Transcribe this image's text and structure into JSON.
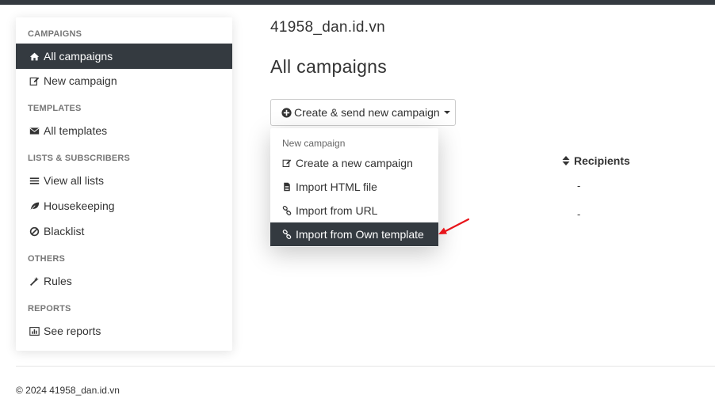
{
  "site_title": "41958_dan.id.vn",
  "page_title": "All campaigns",
  "sidebar": {
    "sections": [
      {
        "heading": "CAMPAIGNS",
        "items": [
          {
            "label": "All campaigns",
            "icon": "home-icon",
            "active": true
          },
          {
            "label": "New campaign",
            "icon": "edit-icon"
          }
        ]
      },
      {
        "heading": "TEMPLATES",
        "items": [
          {
            "label": "All templates",
            "icon": "envelope-icon"
          }
        ]
      },
      {
        "heading": "LISTS & SUBSCRIBERS",
        "items": [
          {
            "label": "View all lists",
            "icon": "list-icon"
          },
          {
            "label": "Housekeeping",
            "icon": "leaf-icon"
          },
          {
            "label": "Blacklist",
            "icon": "ban-icon"
          }
        ]
      },
      {
        "heading": "OTHERS",
        "items": [
          {
            "label": "Rules",
            "icon": "magic-wand-icon"
          }
        ]
      },
      {
        "heading": "REPORTS",
        "items": [
          {
            "label": "See reports",
            "icon": "bar-chart-icon"
          }
        ]
      }
    ]
  },
  "create_button": {
    "label": "Create & send new campaign",
    "icon": "plus-circle-icon"
  },
  "dropdown": {
    "header": "New campaign",
    "items": [
      {
        "label": "Create a new campaign",
        "icon": "edit-icon"
      },
      {
        "label": "Import HTML file",
        "icon": "file-icon"
      },
      {
        "label": "Import from URL",
        "icon": "link-icon"
      },
      {
        "label": "Import from Own template",
        "icon": "link-icon",
        "highlighted": true
      }
    ]
  },
  "table": {
    "recipients_header": "Recipients",
    "recipients_values": [
      "-",
      "-"
    ]
  },
  "annotation": {
    "color": "#e8141a"
  },
  "footer": {
    "text": "© 2024 41958_dan.id.vn"
  },
  "colors": {
    "dark": "#343a40",
    "text": "#333333"
  }
}
